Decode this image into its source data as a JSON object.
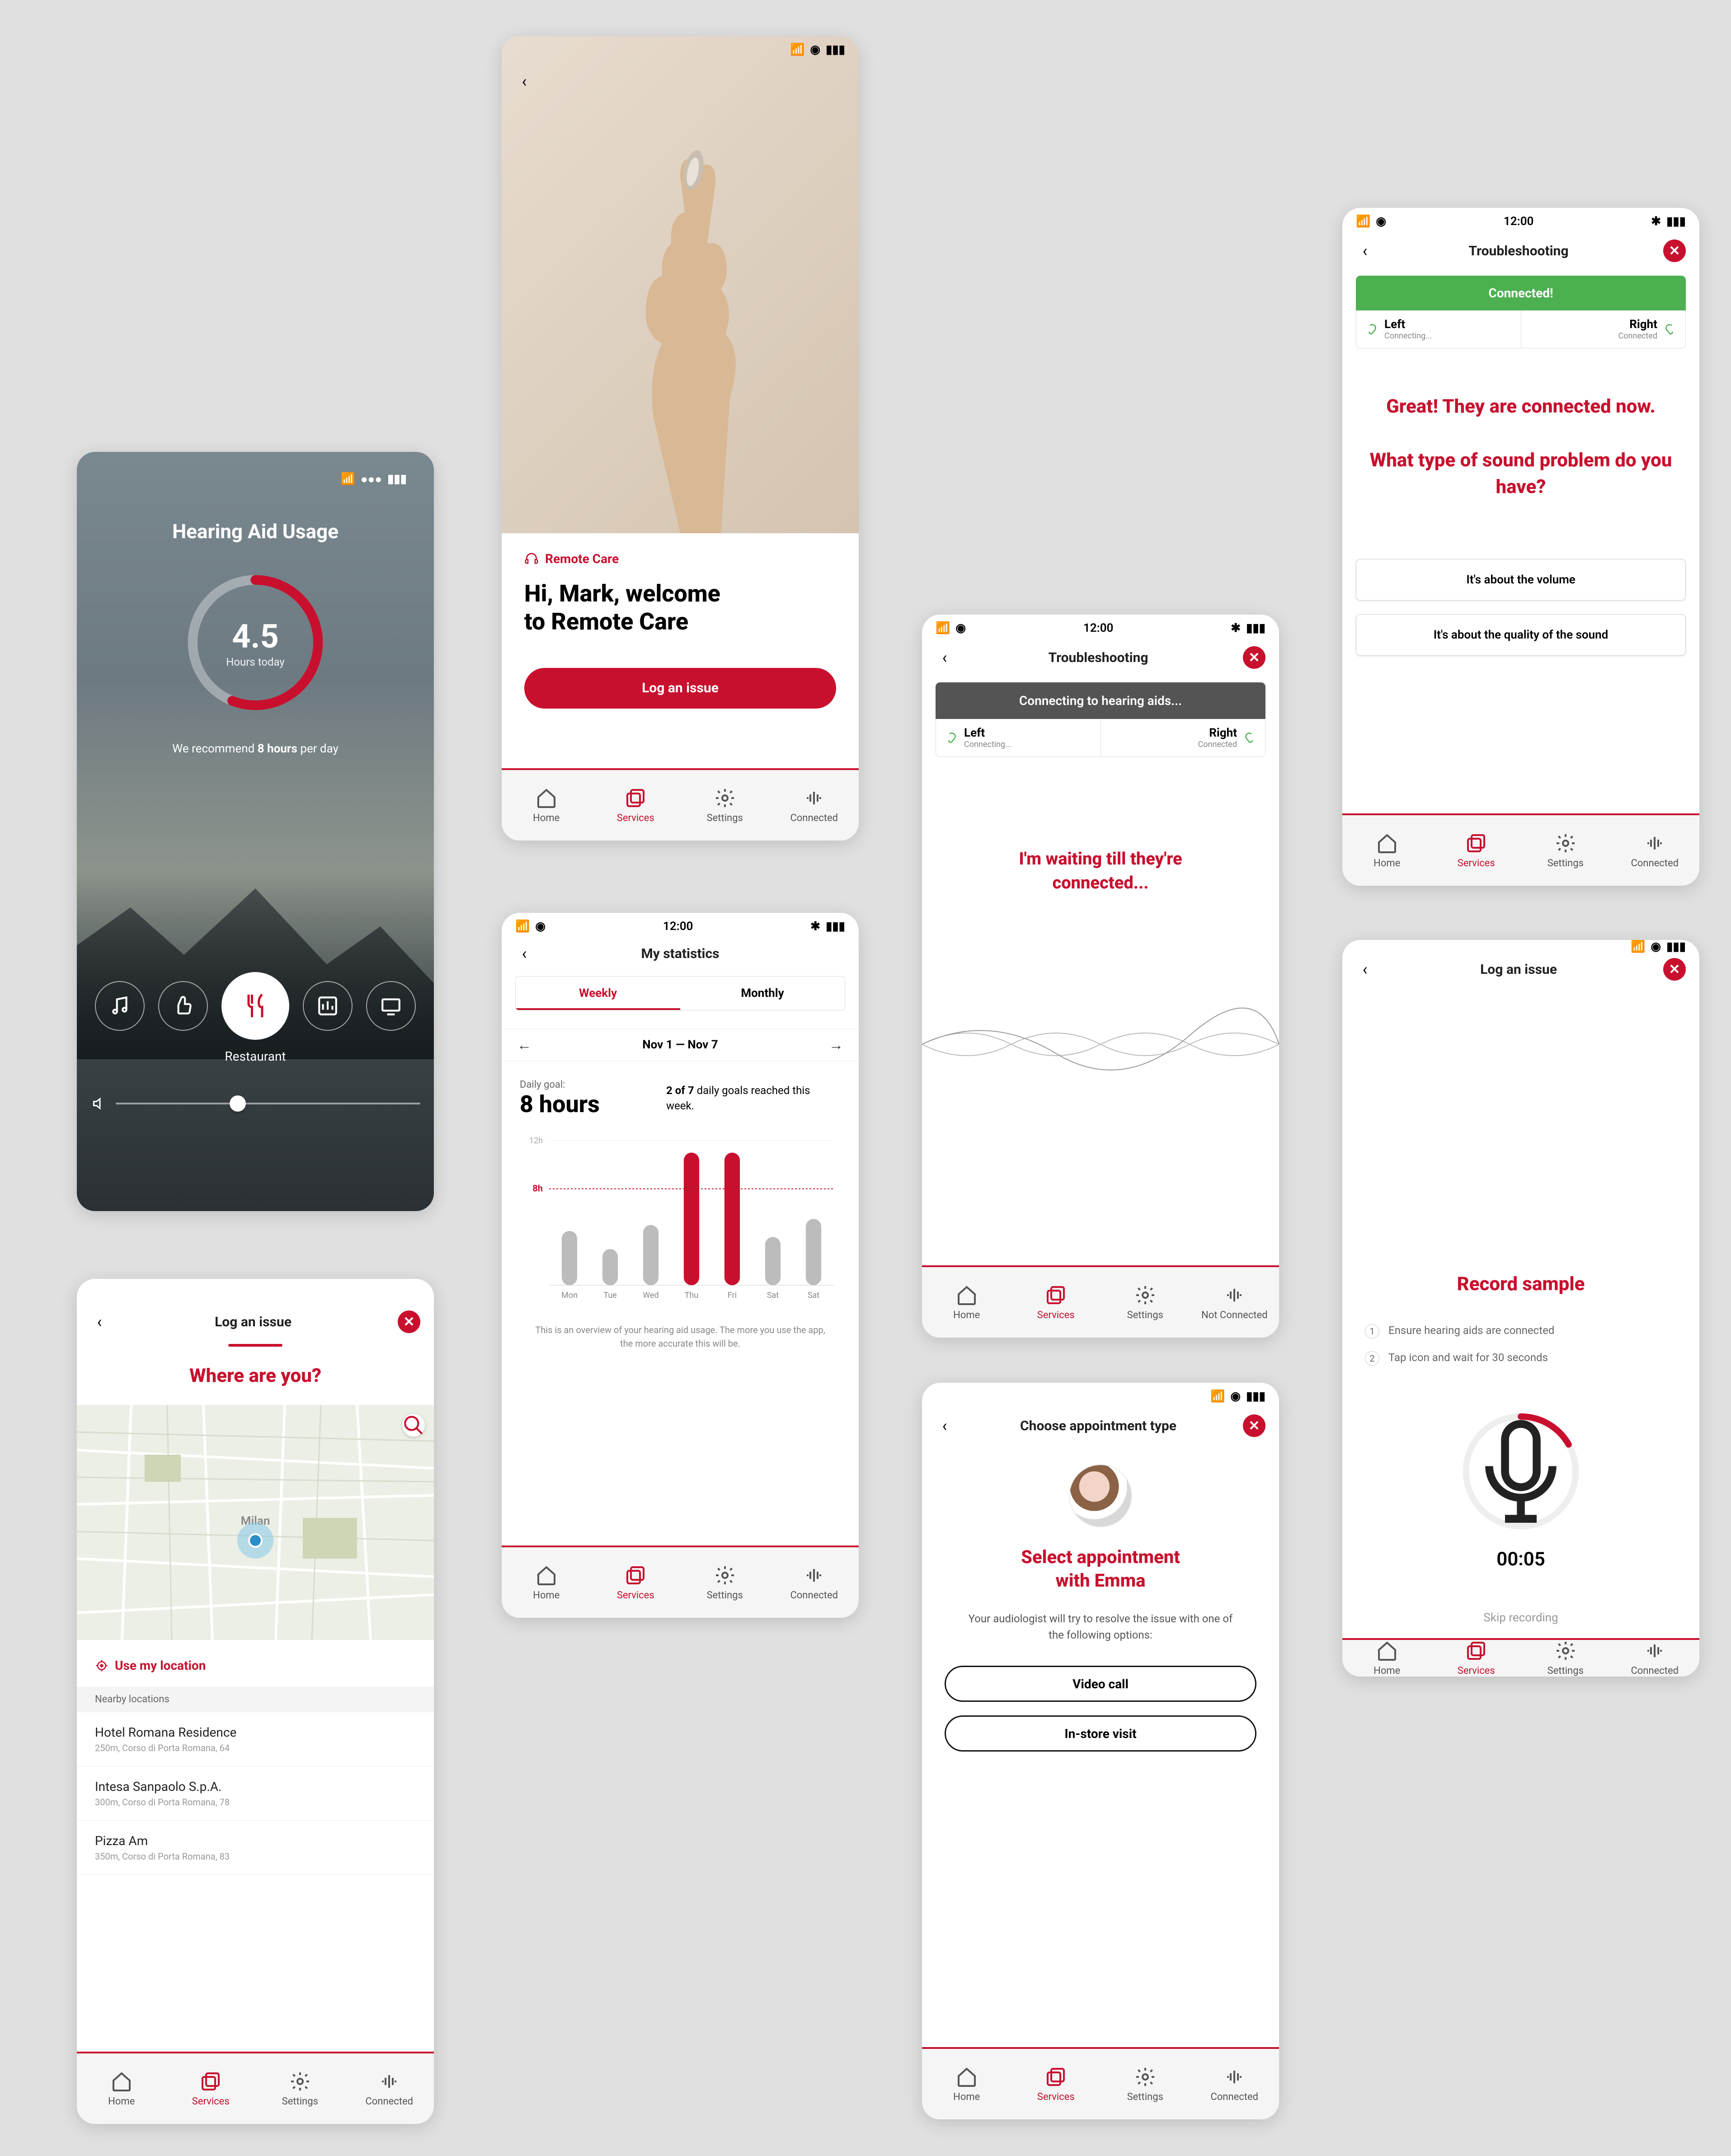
{
  "accent": "#c8102e",
  "nav": {
    "home": "Home",
    "services": "Services",
    "settings": "Settings",
    "connected": "Connected",
    "notConnected": "Not Connected"
  },
  "status": {
    "time": "12:00"
  },
  "s1": {
    "title": "Hearing Aid Usage",
    "ring_value": "4.5",
    "ring_unit": "Hours today",
    "reco_prefix": "We recommend ",
    "reco_bold": "8 hours",
    "reco_suffix": " per day",
    "mode_selected": "Restaurant"
  },
  "s2": {
    "tag": "Remote Care",
    "greeting_line1": "Hi, Mark, welcome",
    "greeting_line2": "to Remote Care",
    "cta": "Log an issue"
  },
  "s3": {
    "title": "Troubleshooting",
    "banner": "Connecting to hearing aids...",
    "left_label": "Left",
    "left_sub": "Connecting...",
    "right_label": "Right",
    "right_sub": "Connected",
    "msg1": "I'm waiting till they're",
    "msg2": "connected..."
  },
  "s4": {
    "title": "Troubleshooting",
    "banner": "Connected!",
    "left_label": "Left",
    "left_sub": "Connecting...",
    "right_label": "Right",
    "right_sub": "Connected",
    "msg1": "Great! They are connected now.",
    "msg2": "What type of sound problem do you have?",
    "opt1": "It's about the volume",
    "opt2": "It's about the quality of the sound"
  },
  "s5": {
    "title": "My statistics",
    "seg_weekly": "Weekly",
    "seg_monthly": "Monthly",
    "range": "Nov 1 — Nov 7",
    "goal_label": "Daily goal:",
    "goal_value": "8 hours",
    "reached_prefix": "2 of 7",
    "reached_suffix": " daily goals reached this week.",
    "chart_ylabel_12": "12h",
    "chart_ylabel_8": "8h",
    "desc": "This is an overview of your hearing aid usage. The more you use the app, the more accurate this will be."
  },
  "s6": {
    "title": "Choose appointment type",
    "heading1": "Select appointment",
    "heading2": "with Emma",
    "sub": "Your audiologist will try to resolve the issue with one of the following options:",
    "opt1": "Video call",
    "opt2": "In-store visit"
  },
  "s7": {
    "title": "Log an issue",
    "subtitle": "Record sample",
    "step1": "Ensure hearing aids are connected",
    "step2": "Tap icon and wait for 30 seconds",
    "timer": "00:05",
    "skip": "Skip recording"
  },
  "s8": {
    "title": "Log an issue",
    "subtitle": "Where are you?",
    "useloc": "Use my location",
    "nearby_header": "Nearby locations",
    "locs": [
      {
        "name": "Hotel Romana Residence",
        "addr": "250m, Corso di Porta Romana, 64"
      },
      {
        "name": "Intesa Sanpaolo S.p.A.",
        "addr": "300m, Corso di Porta Romana, 78"
      },
      {
        "name": "Pizza Am",
        "addr": "350m, Corso di Porta Romana, 83"
      }
    ]
  },
  "chart_data": {
    "type": "bar",
    "title": "My statistics — Weekly",
    "xlabel": "",
    "ylabel": "Hours",
    "ylim": [
      0,
      12
    ],
    "goal_line": 8,
    "categories": [
      "Mon",
      "Tue",
      "Wed",
      "Thu",
      "Fri",
      "Sat",
      "Sat"
    ],
    "values": [
      4.5,
      3,
      5,
      11,
      11,
      4,
      5.5
    ]
  }
}
